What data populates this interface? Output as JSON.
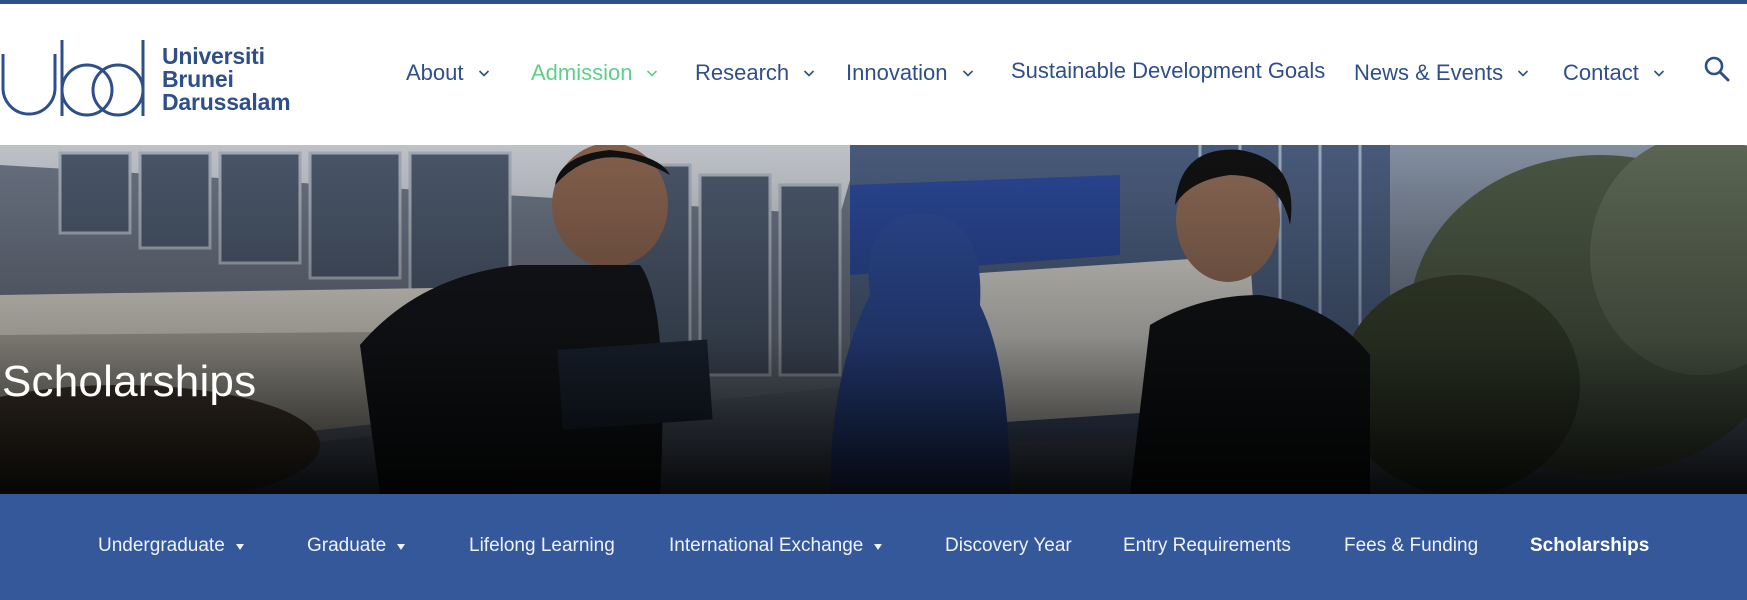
{
  "brand": {
    "line1": "Universiti",
    "line2": "Brunei",
    "line3": "Darussalam",
    "color": "#2f4f8a"
  },
  "nav": {
    "items": [
      {
        "label": "About",
        "has_dropdown": true
      },
      {
        "label": "Admission",
        "has_dropdown": true,
        "active": true
      },
      {
        "label": "Research",
        "has_dropdown": true
      },
      {
        "label": "Innovation",
        "has_dropdown": true
      },
      {
        "label": "Sustainable Development Goals",
        "has_dropdown": false
      },
      {
        "label": "News & Events",
        "has_dropdown": true
      },
      {
        "label": "Contact",
        "has_dropdown": true
      }
    ],
    "search_icon": "search-icon",
    "active_color": "#5fcf8a"
  },
  "hero": {
    "title": "Scholarships"
  },
  "subnav": {
    "items": [
      {
        "label": "Undergraduate",
        "has_dropdown": true
      },
      {
        "label": "Graduate",
        "has_dropdown": true
      },
      {
        "label": "Lifelong Learning",
        "has_dropdown": false
      },
      {
        "label": "International Exchange",
        "has_dropdown": true
      },
      {
        "label": "Discovery Year",
        "has_dropdown": false
      },
      {
        "label": "Entry Requirements",
        "has_dropdown": false
      },
      {
        "label": "Fees & Funding",
        "has_dropdown": false
      },
      {
        "label": "Scholarships",
        "has_dropdown": false,
        "current": true
      }
    ],
    "background": "#34589a"
  }
}
